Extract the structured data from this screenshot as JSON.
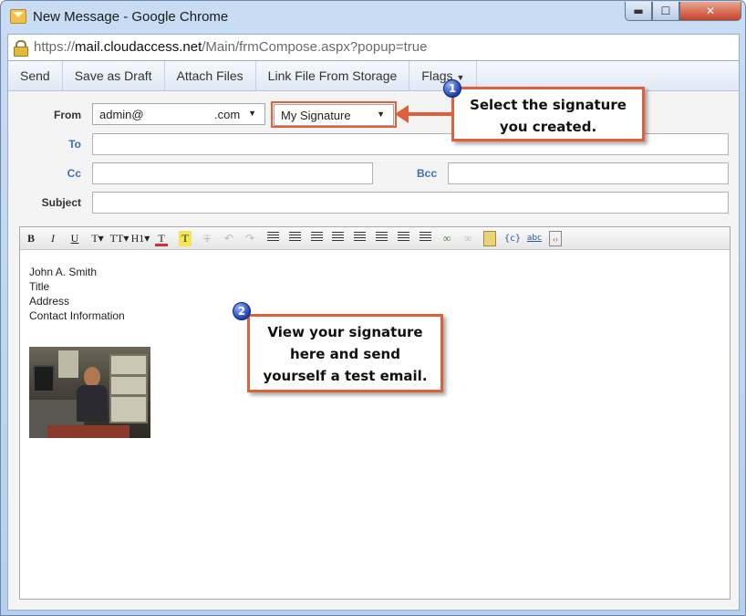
{
  "window": {
    "title": "New Message - Google Chrome",
    "minimize_glyph": "▬",
    "maximize_glyph": "☐",
    "close_glyph": "✕"
  },
  "address": {
    "scheme": "https://",
    "host": "mail.cloudaccess.net",
    "path": "/Main/frmCompose.aspx?popup=true"
  },
  "toolbar": {
    "send_label": "Send",
    "save_draft_label": "Save as Draft",
    "attach_label": "Attach Files",
    "link_file_label": "Link File From Storage",
    "flags_label": "Flags",
    "flags_caret": "▼"
  },
  "form": {
    "from_label": "From",
    "from_value": "admin@",
    "from_domain": ".com",
    "signature_value": "My Signature",
    "dropdown_arrow": "▼",
    "to_label": "To",
    "cc_label": "Cc",
    "bcc_label": "Bcc",
    "subject_label": "Subject"
  },
  "editor": {
    "buttons": {
      "bold": "B",
      "italic": "I",
      "underline": "U",
      "font": "T▾",
      "size": "TT▾",
      "heading": "H1▾",
      "color": "T",
      "highlight": "T",
      "clear": "T",
      "undo": "↶",
      "redo": "↷",
      "spellcheck": "abc",
      "code": "{c}",
      "source": "‹›"
    },
    "signature_lines": [
      "John A. Smith",
      "Title",
      "Address",
      "Contact Information"
    ]
  },
  "callouts": {
    "one_badge": "1",
    "one_line1": "Select the signature",
    "one_line2": "you created.",
    "two_badge": "2",
    "two_line1": "View your signature",
    "two_line2": "here and send",
    "two_line3": "yourself a test email."
  },
  "colors": {
    "accent": "#e0603b",
    "link": "#3a6fb8",
    "badge": "#1d3fae"
  }
}
